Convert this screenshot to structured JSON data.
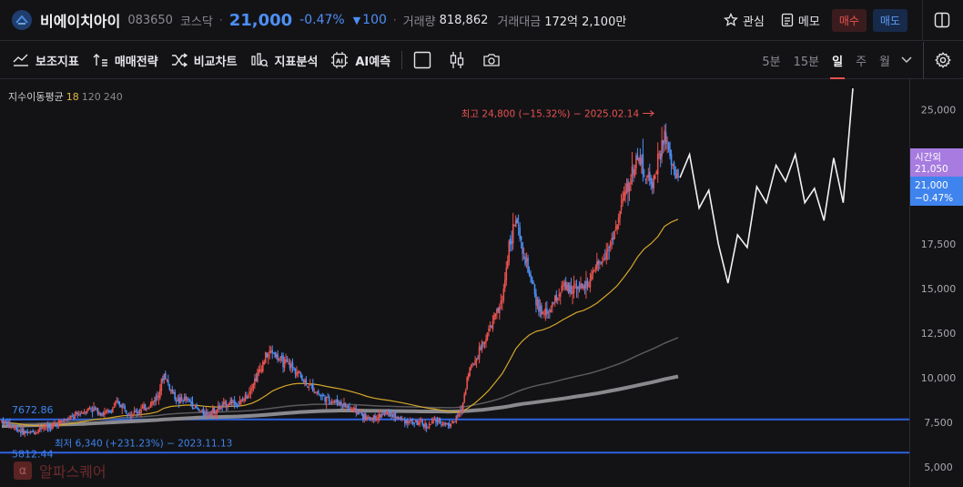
{
  "header": {
    "stock_name": "비에이치아이",
    "code": "083650",
    "market": "코스닥",
    "price": "21,000",
    "change_pct": "-0.47%",
    "change_abs": "100",
    "volume_label": "거래량",
    "volume": "818,862",
    "amount_label": "거래대금",
    "amount": "172억 2,100만",
    "watch_label": "관심",
    "memo_label": "메모",
    "buy_label": "매수",
    "sell_label": "매도",
    "colors": {
      "up": "#e8524e",
      "down": "#4d8ff5"
    }
  },
  "toolbar": {
    "indicators_label": "보조지표",
    "strategy_label": "매매전략",
    "compare_label": "비교차트",
    "analysis_label": "지표분석",
    "ai_label": "AI예측",
    "timeframes": [
      "5분",
      "15분",
      "일",
      "주",
      "월"
    ],
    "active_timeframe": "일"
  },
  "ma_legend": {
    "label": "지수이동평균",
    "p1": "18",
    "p2": "120",
    "p3": "240"
  },
  "watermark": {
    "text": "알파스퀘어",
    "logo_glyph": "α"
  },
  "chart_data": {
    "type": "candlestick",
    "ylim": [
      4400,
      26000
    ],
    "y_ticks": [
      5000,
      7500,
      10000,
      12500,
      15000,
      17500,
      20000,
      22500,
      25000
    ],
    "y_tick_labels": [
      "5,000",
      "7,500",
      "10,000",
      "12,500",
      "15,000",
      "17,500",
      "20,000",
      "22,500",
      "25,000"
    ],
    "max_annotation": {
      "text": "최고 24,800 (−15.32%) − 2025.02.14",
      "value": 24800
    },
    "min_annotation": {
      "text": "최저 6,340 (+231.23%) − 2023.11.13",
      "value": 6340
    },
    "horizontal_lines": [
      {
        "value": 7672.86,
        "label": "7672.86",
        "color": "#2d62e0"
      },
      {
        "value": 5812.44,
        "label": "5812.44",
        "color": "#2d62e0"
      }
    ],
    "price_tags": [
      {
        "label": "시간외",
        "value": "21,050",
        "color": "#a77be0"
      },
      {
        "label": "21,000",
        "value": "−0.47%",
        "color": "#3f84ee"
      }
    ],
    "close_path": [
      7600,
      7400,
      7200,
      7000,
      6900,
      7000,
      7300,
      7200,
      7400,
      7600,
      7700,
      7900,
      8100,
      8300,
      8200,
      8000,
      8100,
      8600,
      8400,
      8000,
      8100,
      8300,
      8500,
      9000,
      10200,
      9300,
      8700,
      8800,
      8600,
      8200,
      8000,
      8100,
      8300,
      8500,
      8700,
      8500,
      8900,
      9600,
      10300,
      11200,
      11500,
      11000,
      10800,
      10600,
      10200,
      9700,
      9400,
      9100,
      8800,
      8700,
      8600,
      8400,
      8200,
      8000,
      7700,
      7800,
      7900,
      8000,
      7900,
      7700,
      7600,
      7500,
      7400,
      7300,
      7600,
      7500,
      7400,
      7600,
      8200,
      10400,
      11000,
      11900,
      12600,
      13500,
      14300,
      17500,
      18800,
      17000,
      15800,
      14300,
      13500,
      13800,
      14500,
      15100,
      14900,
      15300,
      15000,
      15500,
      16100,
      16800,
      17600,
      18600,
      20200,
      21200,
      22500,
      21500,
      20800,
      22000,
      23500,
      22000,
      21000
    ],
    "ema18": [
      7500,
      7480,
      7450,
      7400,
      7350,
      7320,
      7320,
      7320,
      7340,
      7380,
      7420,
      7480,
      7550,
      7620,
      7680,
      7720,
      7760,
      7830,
      7880,
      7900,
      7920,
      7960,
      8010,
      8100,
      8300,
      8400,
      8430,
      8470,
      8480,
      8450,
      8410,
      8380,
      8370,
      8380,
      8410,
      8420,
      8470,
      8580,
      8760,
      9000,
      9260,
      9430,
      9560,
      9650,
      9690,
      9680,
      9650,
      9600,
      9520,
      9450,
      9380,
      9300,
      9200,
      9090,
      8960,
      8870,
      8800,
      8750,
      8690,
      8620,
      8540,
      8460,
      8380,
      8300,
      8250,
      8190,
      8130,
      8090,
      8100,
      8330,
      8600,
      8930,
      9300,
      9760,
      10240,
      10920,
      11630,
      12070,
      12400,
      12600,
      12690,
      12830,
      13030,
      13260,
      13460,
      13660,
      13770,
      13950,
      14180,
      14490,
      14810,
      15160,
      15640,
      16150,
      16760,
      17220,
      17520,
      17900,
      18480,
      18720,
      18880
    ],
    "ema120": [
      7400,
      7410,
      7420,
      7430,
      7440,
      7450,
      7470,
      7490,
      7510,
      7530,
      7550,
      7580,
      7610,
      7640,
      7670,
      7690,
      7710,
      7740,
      7770,
      7790,
      7810,
      7830,
      7860,
      7890,
      7940,
      7970,
      8000,
      8020,
      8040,
      8060,
      8070,
      8080,
      8090,
      8100,
      8120,
      8130,
      8150,
      8170,
      8210,
      8250,
      8300,
      8350,
      8400,
      8440,
      8470,
      8490,
      8510,
      8520,
      8520,
      8520,
      8520,
      8510,
      8500,
      8480,
      8460,
      8440,
      8420,
      8410,
      8400,
      8390,
      8380,
      8370,
      8360,
      8350,
      8340,
      8340,
      8330,
      8340,
      8360,
      8420,
      8490,
      8570,
      8660,
      8760,
      8880,
      9030,
      9200,
      9340,
      9460,
      9560,
      9640,
      9720,
      9810,
      9910,
      10000,
      10090,
      10170,
      10260,
      10370,
      10490,
      10620,
      10750,
      10900,
      11070,
      11250,
      11420,
      11580,
      11750,
      11940,
      12100,
      12250
    ],
    "ema240": [
      7300,
      7310,
      7320,
      7330,
      7340,
      7350,
      7360,
      7370,
      7380,
      7390,
      7400,
      7410,
      7420,
      7440,
      7460,
      7480,
      7500,
      7520,
      7540,
      7560,
      7580,
      7600,
      7620,
      7640,
      7670,
      7690,
      7710,
      7730,
      7750,
      7770,
      7790,
      7800,
      7810,
      7820,
      7830,
      7840,
      7860,
      7880,
      7900,
      7930,
      7960,
      7990,
      8020,
      8050,
      8080,
      8100,
      8120,
      8140,
      8150,
      8160,
      8170,
      8170,
      8170,
      8170,
      8160,
      8160,
      8150,
      8150,
      8140,
      8140,
      8130,
      8130,
      8120,
      8120,
      8120,
      8120,
      8110,
      8120,
      8130,
      8150,
      8180,
      8210,
      8250,
      8300,
      8350,
      8410,
      8480,
      8540,
      8590,
      8640,
      8690,
      8740,
      8790,
      8840,
      8900,
      8960,
      9010,
      9070,
      9130,
      9200,
      9270,
      9340,
      9420,
      9500,
      9580,
      9660,
      9740,
      9830,
      9920,
      10000,
      10080
    ],
    "forecast_path": [
      21200,
      22500,
      19500,
      20500,
      17500,
      15300,
      18000,
      17300,
      20700,
      19800,
      21900,
      21000,
      22500,
      19800,
      20600,
      18800,
      22300,
      19800,
      26200
    ]
  }
}
